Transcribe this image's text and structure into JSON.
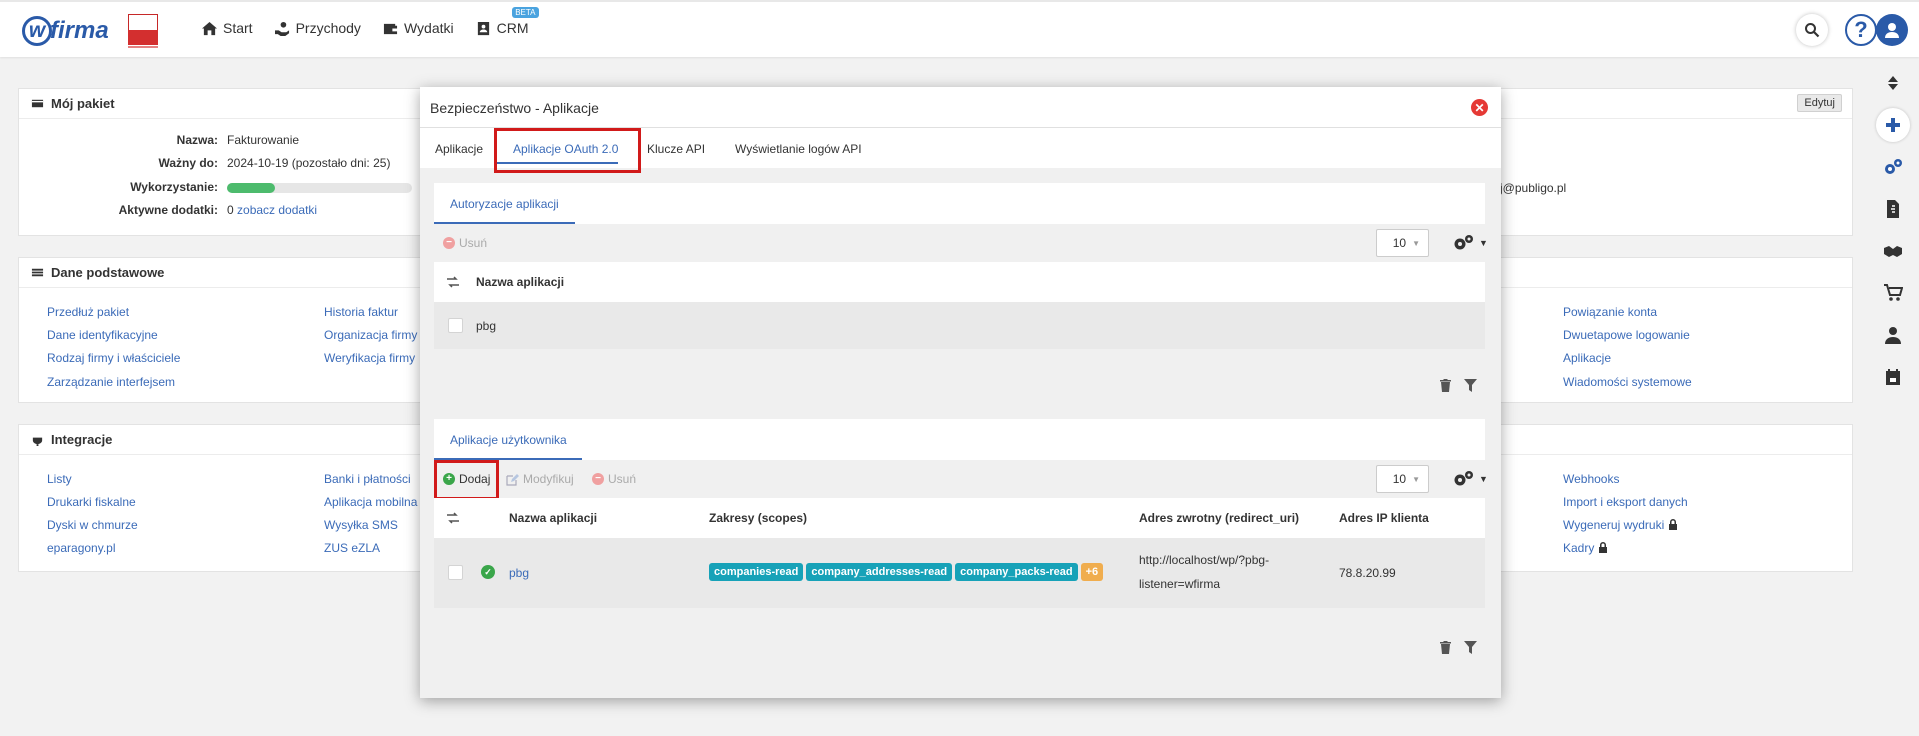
{
  "topbar": {
    "logo_text": "firma",
    "logo_w": "w",
    "nav": [
      {
        "label": "Start",
        "icon": "home-icon"
      },
      {
        "label": "Przychody",
        "icon": "hand-coins-icon"
      },
      {
        "label": "Wydatki",
        "icon": "wallet-icon"
      },
      {
        "label": "CRM",
        "icon": "contact-card-icon",
        "badge": "BETA"
      }
    ],
    "help_label": "?"
  },
  "package_panel": {
    "title": "Mój pakiet",
    "edit_label": "Edytuj",
    "rows": [
      {
        "key": "Nazwa:",
        "value": "Fakturowanie"
      },
      {
        "key": "Ważny do:",
        "value": "2024-10-19 (pozostało dni: 25)"
      },
      {
        "key": "Wykorzystanie:",
        "value": ""
      },
      {
        "key": "Aktywne dodatki:",
        "value": "0",
        "link": "zobacz dodatki"
      }
    ],
    "usage_fraction": 0.26,
    "email_fragment": "j@publigo.pl"
  },
  "basic_panel": {
    "title": "Dane podstawowe",
    "col1": [
      "Przedłuż pakiet",
      "Dane identyfikacyjne",
      "Rodzaj firmy i właściciele",
      "Zarządzanie interfejsem"
    ],
    "col2": [
      "Historia faktur",
      "Organizacja firmy",
      "Weryfikacja firmy"
    ],
    "col3": [
      "Powiązanie konta",
      "Dwuetapowe logowanie",
      "Aplikacje",
      "Wiadomości systemowe"
    ]
  },
  "integrations_panel": {
    "title": "Integracje",
    "col1": [
      "Listy",
      "Drukarki fiskalne",
      "Dyski w chmurze",
      "eparagony.pl"
    ],
    "col2": [
      "Banki i płatności",
      "Aplikacja mobilna",
      "Wysyłka SMS",
      "ZUS eZLA"
    ],
    "col3": [
      "Webhooks",
      "Import i eksport danych",
      "Wygeneruj wydruki",
      "Kadry"
    ]
  },
  "modal": {
    "title": "Bezpieczeństwo - Aplikacje",
    "close_label": "✕",
    "tabs": [
      "Aplikacje",
      "Aplikacje OAuth 2.0",
      "Klucze API",
      "Wyświetlanie logów API"
    ],
    "active_tab": "Aplikacje OAuth 2.0",
    "authorizations": {
      "subtab": "Autoryzacje aplikacji",
      "delete_label": "Usuń",
      "page_size": "10",
      "column": "Nazwa aplikacji",
      "rows": [
        {
          "name": "pbg"
        }
      ]
    },
    "user_apps": {
      "subtab": "Aplikacje użytkownika",
      "add_label": "Dodaj",
      "modify_label": "Modyfikuj",
      "delete_label": "Usuń",
      "page_size": "10",
      "columns": [
        "Nazwa aplikacji",
        "Zakresy (scopes)",
        "Adres zwrotny (redirect_uri)",
        "Adres IP klienta"
      ],
      "rows": [
        {
          "name": "pbg",
          "scopes": [
            "companies-read",
            "company_addresses-read",
            "company_packs-read"
          ],
          "more_scopes": "+6",
          "redirect_uri_line1": "http://localhost/wp/?pbg-",
          "redirect_uri_line2": "listener=wfirma",
          "client_ip": "78.8.20.99"
        }
      ]
    }
  },
  "colors": {
    "brand": "#2a5aa8",
    "link": "#3b6bb8",
    "highlight_box": "#d11a1a",
    "scope_tag": "#17a2b8",
    "more_tag": "#f0ad4e",
    "success": "#3aa64a"
  }
}
